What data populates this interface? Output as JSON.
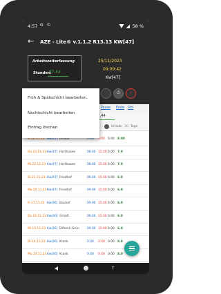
{
  "status_bar": {
    "time": "4:57",
    "icons": [
      "G",
      "©"
    ],
    "battery": "58 %"
  },
  "app_bar": {
    "back_icon": "arrow-left-icon",
    "title": "AZE - Lite® v.1.1.2 R13.13 KW[47]"
  },
  "header": {
    "az_label": "Arbeitszeiterfassung",
    "hours_label": "Stunden:",
    "hours_value": "87,44",
    "date": "25/11/2023",
    "time": "09:09:42",
    "kw": "Kw[47]"
  },
  "tabs": [
    "Pause",
    "Ende",
    "Std"
  ],
  "entry": {
    "value": "87,44"
  },
  "urlaub": {
    "label": "Urlaub:",
    "count": "30",
    "tage": "Tage"
  },
  "menu": {
    "items": [
      "Früh & Spätschicht bearbeiten.",
      "Nachtschicht bearbeiten",
      "Eintrag löschen"
    ]
  },
  "rows": [
    {
      "date": "Fr.24.11.23",
      "kw": "Kw[47]",
      "place": "Urlaub",
      "start": "0.00",
      "end": "0.00",
      "pause": "0.00",
      "hours": "8.00"
    },
    {
      "date": "Do.23.11.23",
      "kw": "Kw[47]",
      "place": "Herthaaee",
      "start": "08.00",
      "end": "15.00",
      "pause": "0.00",
      "hours": "7.0"
    },
    {
      "date": "Mi.22.11.23",
      "kw": "Kw[47]",
      "place": "Herthaaee",
      "start": "08.00",
      "end": "15.00",
      "pause": "0.00",
      "hours": "7.0"
    },
    {
      "date": "Di.21.11.23",
      "kw": "Kw[47]",
      "place": "Friedhof",
      "start": "09.00",
      "end": "15.00",
      "pause": "0.00",
      "hours": "6.0"
    },
    {
      "date": "Mo.20.11.23",
      "kw": "Kw[47]",
      "place": "Friedhof",
      "start": "09.00",
      "end": "15.00",
      "pause": "0.00",
      "hours": "6.0"
    },
    {
      "date": "Fr.17.11.23",
      "kw": "Kw[46]",
      "place": "Bauhof",
      "start": "09.00",
      "end": "15.00",
      "pause": "0.00",
      "hours": "6.0"
    },
    {
      "date": "Do.16.11.23",
      "kw": "Kw[46]",
      "place": "Grünfl.",
      "start": "09.00",
      "end": "15.00",
      "pause": "0.00",
      "hours": "6.0"
    },
    {
      "date": "Mi.15.11.23",
      "kw": "Kw[46]",
      "place": "Elfhenh.Grün",
      "start": "09.00",
      "end": "15.00",
      "pause": "0.00",
      "hours": "6.0"
    },
    {
      "date": "Di.14.11.23",
      "kw": "Kw[46]",
      "place": "Krank",
      "start": "0.00",
      "end": "0.00",
      "pause": "0.00",
      "hours": "8.0"
    },
    {
      "date": "Mo.13.11.23",
      "kw": "Kw[46]",
      "place": "Krank",
      "start": "0.00",
      "end": "0.00",
      "pause": "0.00",
      "hours": "8.0"
    }
  ],
  "fab_icon": "menu-icon",
  "nav": {
    "recent_icon": "†"
  }
}
